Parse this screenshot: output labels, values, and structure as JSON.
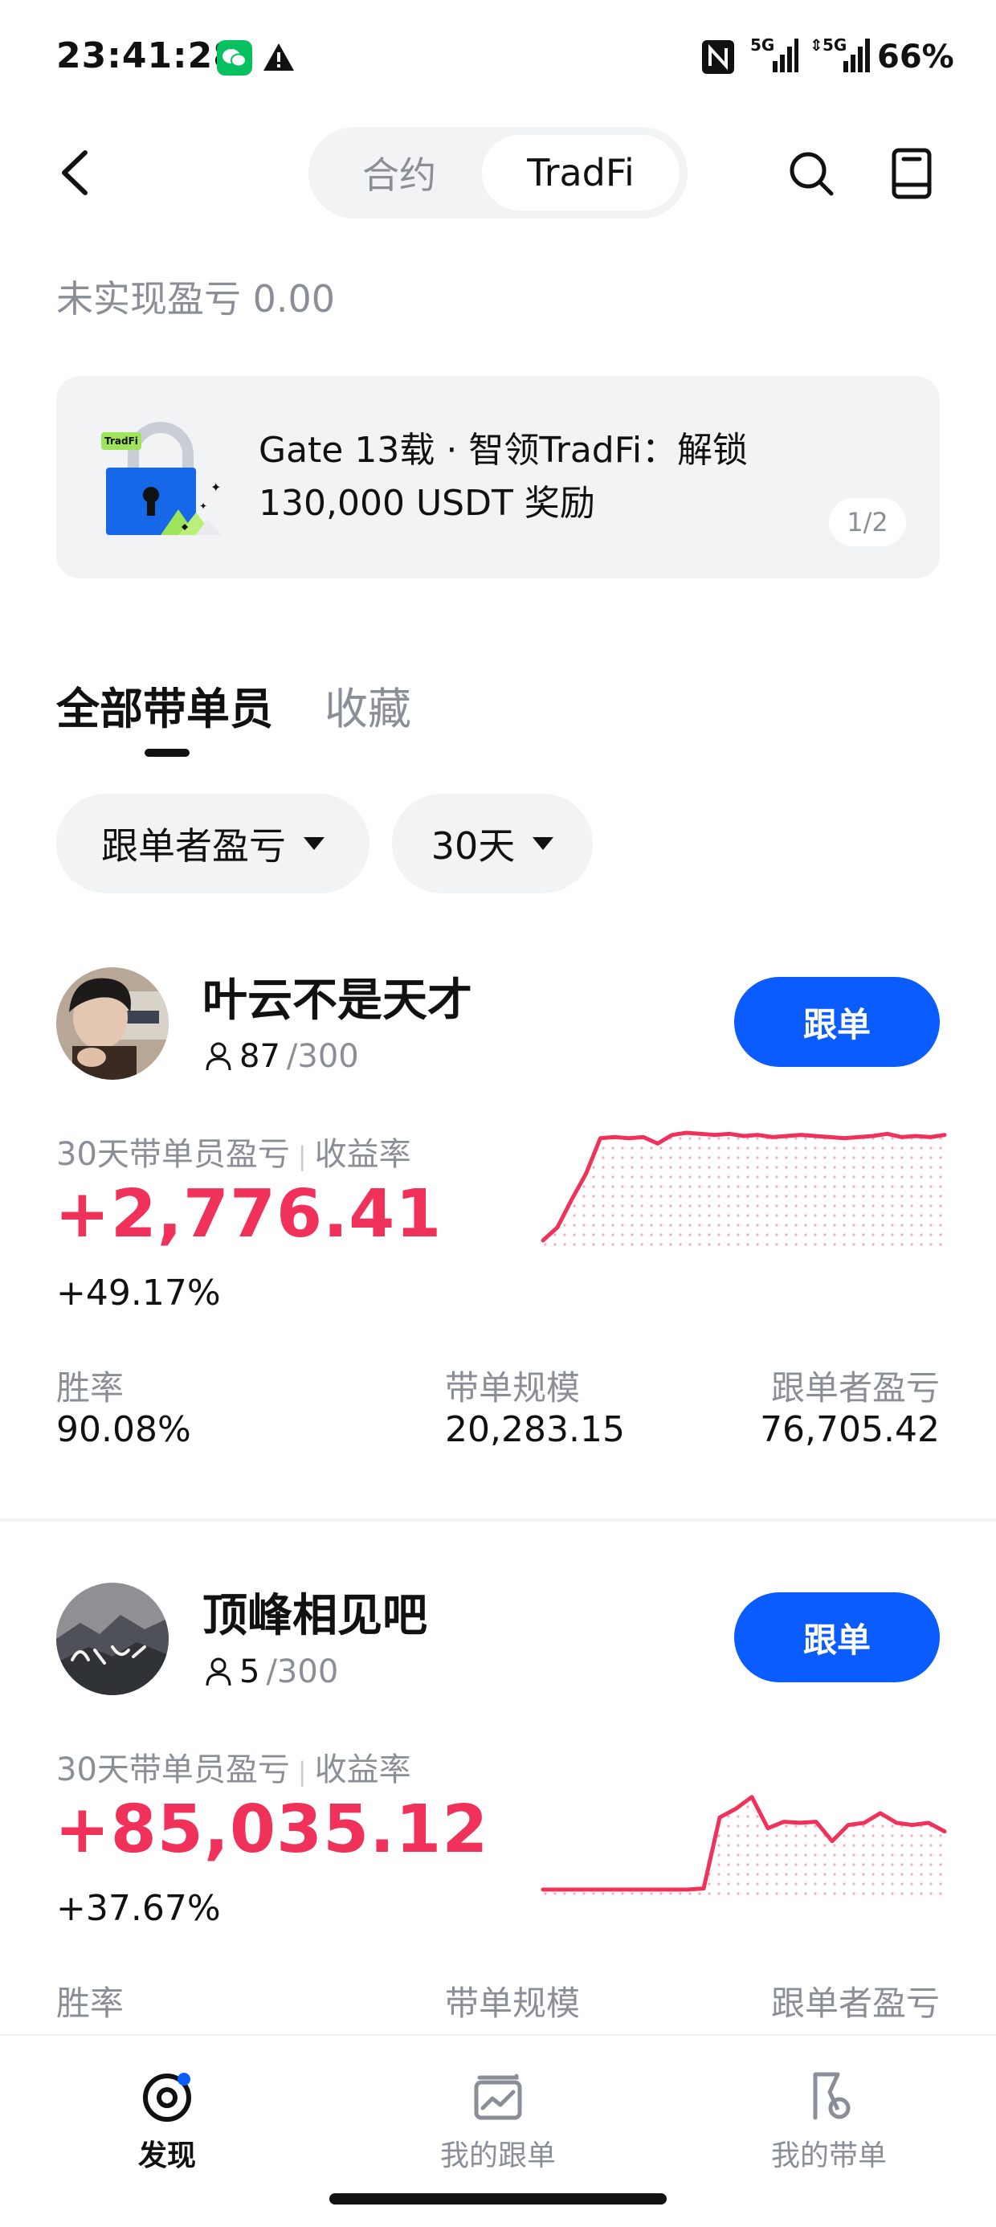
{
  "status_bar": {
    "time": "23:41:28",
    "network_1": "5G",
    "network_2": "5G",
    "battery": "66%"
  },
  "header": {
    "tabs": [
      {
        "label": "合约",
        "active": false
      },
      {
        "label": "TradFi",
        "active": true
      }
    ]
  },
  "unrealized_pnl": "未实现盈亏 0.00",
  "banner": {
    "badge": "TradFi",
    "line1": "Gate 13载 · 智领TradFi：解锁",
    "line2": "130,000 USDT 奖励",
    "page": "1/2"
  },
  "list_tabs": [
    {
      "label": "全部带单员",
      "active": true
    },
    {
      "label": "收藏",
      "active": false
    }
  ],
  "filters": [
    {
      "label": "跟单者盈亏"
    },
    {
      "label": "30天"
    }
  ],
  "traders": [
    {
      "name": "叶云不是天才",
      "followers": "87",
      "followers_max": "/300",
      "follow_label": "跟单",
      "pnl_label": "30天带单员盈亏",
      "roi_label": "收益率",
      "pnl": "+2,776.41",
      "roi": "+49.17%",
      "stats": [
        {
          "label": "胜率",
          "value": "90.08%"
        },
        {
          "label": "带单规模",
          "value": "20,283.15"
        },
        {
          "label": "跟单者盈亏",
          "value": "76,705.42"
        }
      ],
      "sparkline": [
        0.0,
        0.12,
        0.38,
        0.62,
        0.95,
        0.96,
        0.95,
        0.96,
        0.9,
        0.98,
        1.0,
        0.99,
        0.98,
        0.99,
        0.97,
        0.98,
        0.96,
        0.97,
        0.98,
        0.97,
        0.96,
        0.95,
        0.96,
        0.97,
        0.99,
        0.96,
        0.97,
        0.96,
        0.98
      ]
    },
    {
      "name": "顶峰相见吧",
      "followers": "5",
      "followers_max": "/300",
      "follow_label": "跟单",
      "pnl_label": "30天带单员盈亏",
      "roi_label": "收益率",
      "pnl": "+85,035.12",
      "roi": "+37.67%",
      "stats": [
        {
          "label": "胜率",
          "value": ""
        },
        {
          "label": "带单规模",
          "value": ""
        },
        {
          "label": "跟单者盈亏",
          "value": ""
        }
      ],
      "sparkline": [
        0.0,
        0.0,
        0.0,
        0.0,
        0.0,
        0.0,
        0.0,
        0.0,
        0.0,
        0.0,
        0.01,
        0.67,
        0.75,
        0.86,
        0.57,
        0.63,
        0.62,
        0.63,
        0.45,
        0.6,
        0.62,
        0.71,
        0.62,
        0.6,
        0.62,
        0.54
      ]
    }
  ],
  "bottom_nav": [
    {
      "label": "发现",
      "active": true,
      "icon": "discover-icon"
    },
    {
      "label": "我的跟单",
      "active": false,
      "icon": "chart-card-icon"
    },
    {
      "label": "我的带单",
      "active": false,
      "icon": "flag-icon"
    }
  ],
  "colors": {
    "accent_blue": "#0b5cff",
    "profit_red": "#f0325a",
    "muted_gray": "#8a8f97",
    "wechat_green": "#07c160"
  }
}
